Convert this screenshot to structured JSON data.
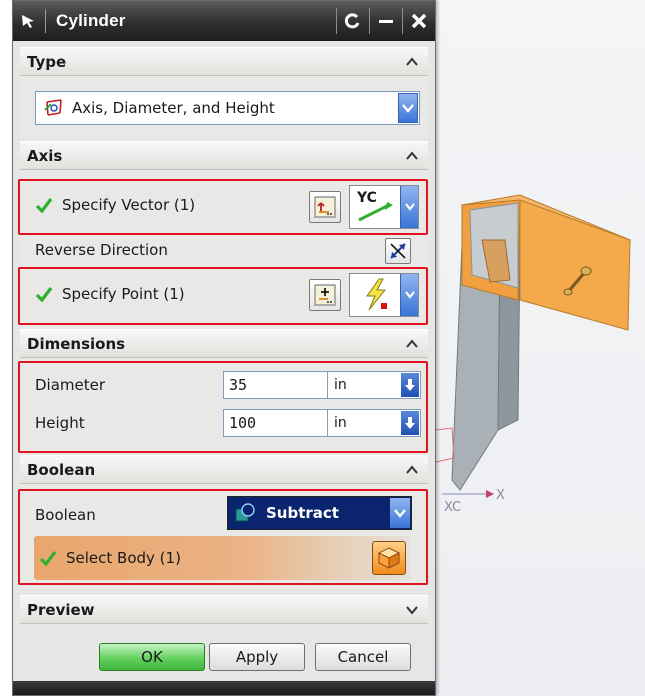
{
  "dialog": {
    "title": "Cylinder",
    "window_buttons": {
      "reset": "↺",
      "minimize": "−",
      "close": "✕"
    }
  },
  "sections": {
    "type": {
      "header": "Type",
      "selected": "Axis, Diameter, and Height"
    },
    "axis": {
      "header": "Axis",
      "specify_vector": "Specify Vector (1)",
      "vector_option": "YC",
      "reverse_direction": "Reverse Direction",
      "specify_point": "Specify Point (1)"
    },
    "dimensions": {
      "header": "Dimensions",
      "diameter_label": "Diameter",
      "diameter_value": "35",
      "diameter_unit": "in",
      "height_label": "Height",
      "height_value": "100",
      "height_unit": "in"
    },
    "boolean": {
      "header": "Boolean",
      "label": "Boolean",
      "selected": "Subtract",
      "select_body": "Select Body (1)"
    },
    "preview": {
      "header": "Preview"
    }
  },
  "footer": {
    "ok": "OK",
    "apply": "Apply",
    "cancel": "Cancel"
  },
  "viewport": {
    "axis_xc": "XC",
    "axis_x": "X"
  },
  "colors": {
    "highlight": "#e0141e",
    "model_orange": "#f0a040",
    "model_grey": "#9aa3aa",
    "check_green": "#2fae2f",
    "boolean_select": "#0a2470"
  },
  "icons": {
    "title": "select-arrow-icon",
    "type": "cylinder-type-icon",
    "check": "check-icon",
    "vector_dialog": "vector-dialog-icon",
    "vector_inferred": "yc-vector-icon",
    "reverse": "reverse-direction-icon",
    "point_dialog": "point-dialog-icon",
    "point_inferred": "inferred-point-icon",
    "boolean": "subtract-icon",
    "body": "solid-body-icon"
  }
}
